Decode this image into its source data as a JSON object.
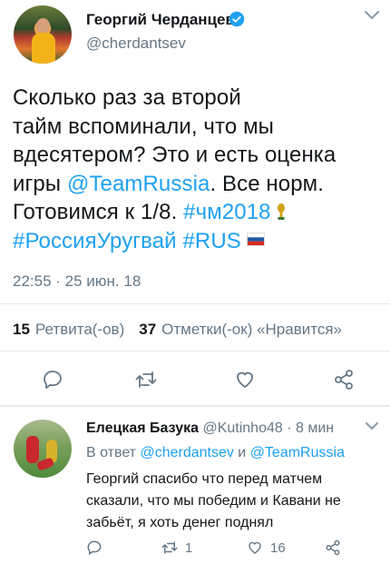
{
  "author": {
    "name": "Георгий Черданцев",
    "handle": "@cherdantsev"
  },
  "tweet": {
    "line1": "Сколько раз за второй",
    "line2": "тайм вспоминали, что мы",
    "line3": "вдесятером? Это и есть оценка",
    "line4_pre": "игры ",
    "mention": "@TeamRussia",
    "line4_post": ". Все норм.",
    "line5_pre": "Готовимся к 1/8. ",
    "hashtag1": "#чм2018",
    "hashtag2": "#РоссияУругвай",
    "hashtag3": "#RUS",
    "timestamp": "22:55 · 25 июн. 18"
  },
  "stats": {
    "retweets_count": "15",
    "retweets_label": "Ретвита(-ов)",
    "likes_count": "37",
    "likes_label": "Отметки(-ок) «Нравится»"
  },
  "reply": {
    "name": "Елецкая Базука",
    "handle": "@Kutinho48",
    "time": "· 8 мин",
    "in_reply_prefix": "В ответ ",
    "to1": "@cherdantsev",
    "and": " и ",
    "to2": "@TeamRussia",
    "text": "Георгий спасибо что перед матчем сказали, что мы победим и Кавани не забьёт, я хоть денег поднял",
    "retweets": "1",
    "likes": "16"
  },
  "colors": {
    "accent": "#1da1f2",
    "muted": "#657786",
    "text": "#14171a"
  },
  "icons": [
    "verified-badge-icon",
    "chevron-down-icon",
    "reply-icon",
    "retweet-icon",
    "like-icon",
    "share-icon",
    "world-cup-trophy-emoji",
    "russia-flag-emoji"
  ]
}
